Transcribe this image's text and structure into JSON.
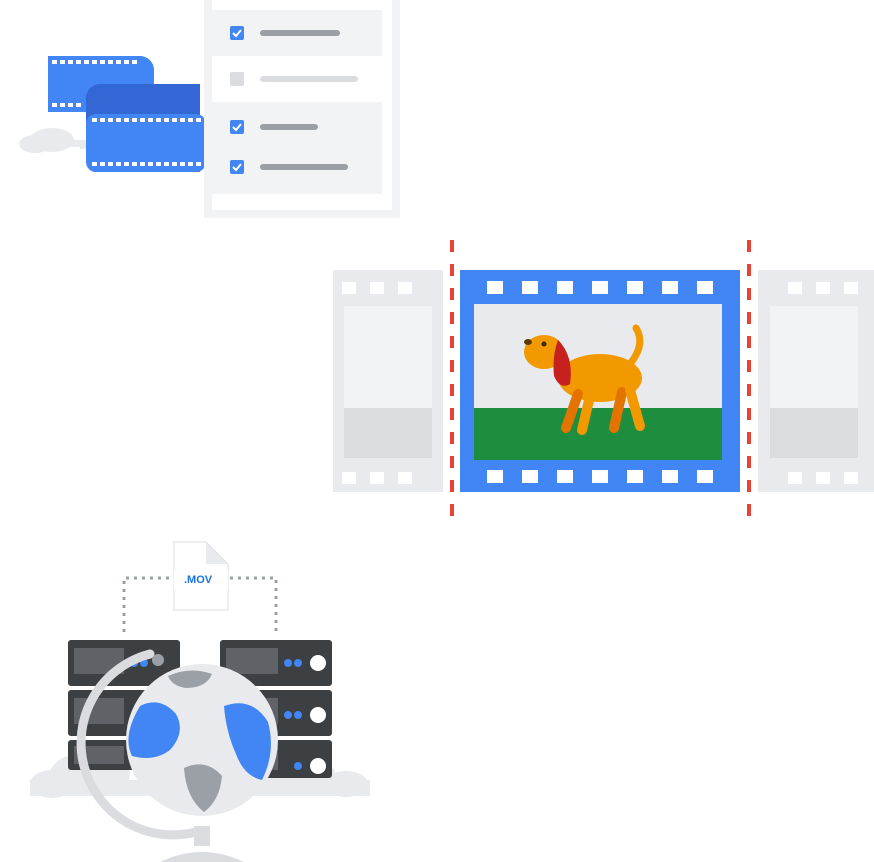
{
  "file_label": ".MOV",
  "checklist": [
    {
      "checked": true
    },
    {
      "checked": false
    },
    {
      "checked": true
    },
    {
      "checked": true
    }
  ],
  "icons": {
    "checklist_group": "film-checklist-illustration",
    "trim_group": "film-trim-illustration",
    "server_group": "server-globe-illustration"
  },
  "colors": {
    "blue": "#4285f4",
    "dark_blue": "#3367d6",
    "red": "#ea4335",
    "green": "#1e8e3e",
    "orange": "#f29900",
    "gray_light": "#e8eaed",
    "gray_mid": "#dadce0",
    "gray_dark": "#9aa0a6",
    "server": "#3c4043"
  }
}
